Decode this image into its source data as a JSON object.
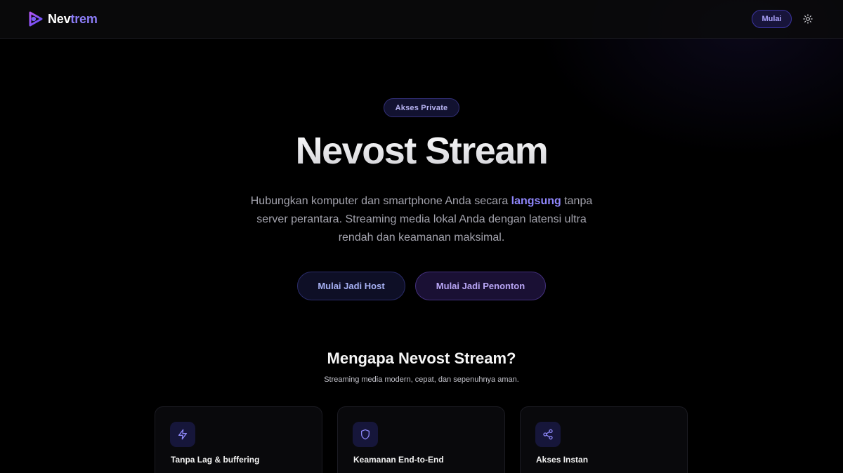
{
  "header": {
    "logo_part1": "Nev",
    "logo_part2": "trem",
    "start_label": "Mulai",
    "theme_icon": "sun-icon"
  },
  "hero": {
    "badge": "Akses Private",
    "title": "Nevost Stream",
    "desc_before": "Hubungkan komputer dan smartphone Anda secara ",
    "desc_highlight": "langsung",
    "desc_after": " tanpa server perantara. Streaming media lokal Anda dengan latensi ultra rendah dan keamanan maksimal.",
    "cta_host": "Mulai Jadi Host",
    "cta_viewer": "Mulai Jadi Penonton"
  },
  "why": {
    "title": "Mengapa Nevost Stream?",
    "subtitle": "Streaming media modern, cepat, dan sepenuhnya aman.",
    "cards": [
      {
        "icon": "lightning-icon",
        "title": "Tanpa Lag & buffering"
      },
      {
        "icon": "shield-icon",
        "title": "Keamanan End-to-End"
      },
      {
        "icon": "share-icon",
        "title": "Akses Instan"
      }
    ]
  },
  "colors": {
    "accent": "#8b7cf6",
    "background": "#000000",
    "highlight": "#8f86fb"
  }
}
